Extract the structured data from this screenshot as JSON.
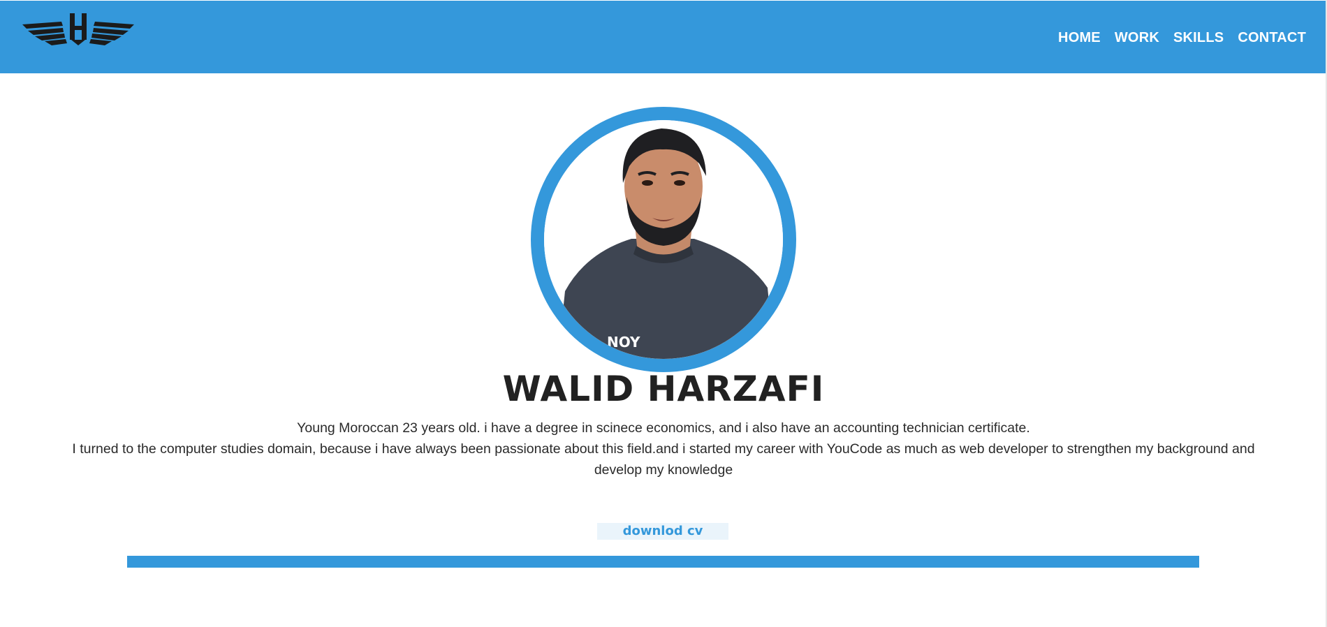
{
  "header": {
    "logo_icon": "winged-h-logo-icon",
    "nav": [
      {
        "label": "HOME"
      },
      {
        "label": "WORK"
      },
      {
        "label": "SKILLS"
      },
      {
        "label": "CONTACT"
      }
    ]
  },
  "profile": {
    "avatar_icon": "profile-photo",
    "name": "WALID HARZAFI",
    "bio_line_1": "Young Moroccan 23 years old. i have a degree in scinece economics, and i also have an accounting technician certificate.",
    "bio_line_2": "I turned to the computer studies domain, because i have always been passionate about this field.and i started my career with YouCode as much as web developer to strengthen my background and develop my knowledge",
    "cv_button_label": "downlod cv"
  },
  "colors": {
    "accent": "#3498db",
    "text": "#222222",
    "background": "#ffffff",
    "button_bg": "#eaf4fb"
  }
}
